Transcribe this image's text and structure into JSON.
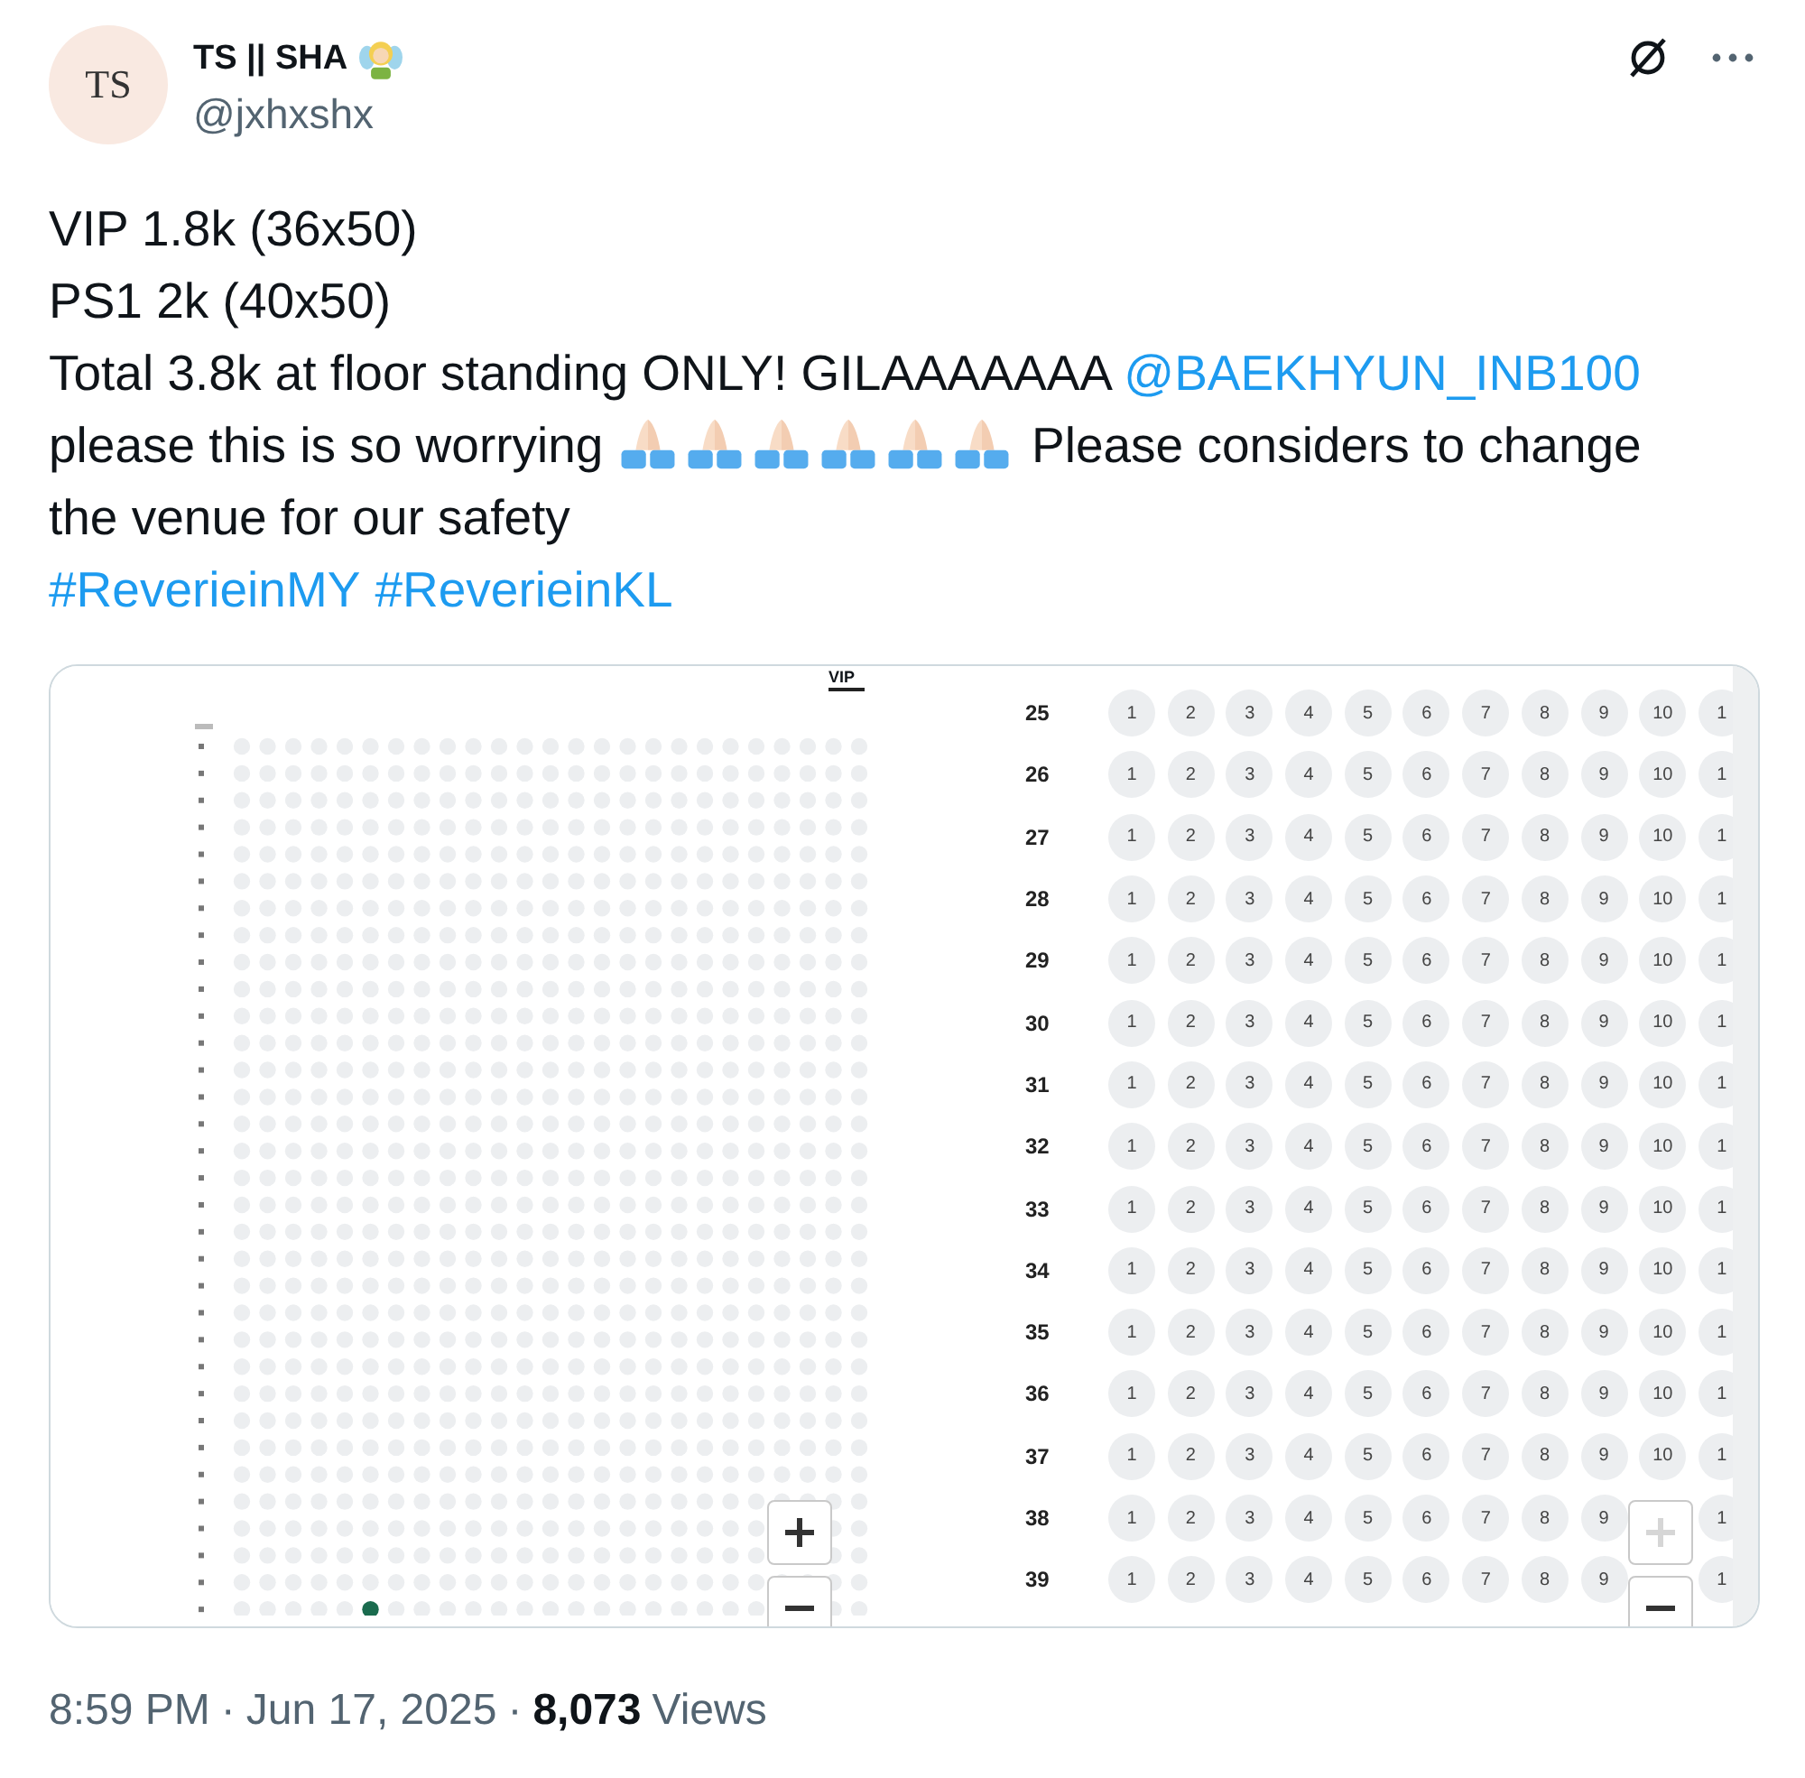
{
  "author": {
    "avatar_text": "TS",
    "name": "TS || SHA",
    "handle": "@jxhxshx"
  },
  "body": {
    "lines": [
      {
        "parts": [
          {
            "kind": "text",
            "text": "VIP 1.8k (36x50)"
          }
        ]
      },
      {
        "parts": [
          {
            "kind": "text",
            "text": "PS1 2k (40x50)"
          }
        ]
      },
      {
        "parts": [
          {
            "kind": "text",
            "text": "Total 3.8k at floor standing ONLY! GILAAAAAAA "
          },
          {
            "kind": "mention",
            "text": "@BAEKHYUN_INB100"
          }
        ]
      },
      {
        "parts": [
          {
            "kind": "text",
            "text": "please this is so worrying "
          },
          {
            "kind": "pray"
          },
          {
            "kind": "pray"
          },
          {
            "kind": "pray"
          },
          {
            "kind": "pray"
          },
          {
            "kind": "pray"
          },
          {
            "kind": "pray"
          },
          {
            "kind": "text",
            "text": " Please considers to change"
          }
        ]
      },
      {
        "parts": [
          {
            "kind": "text",
            "text": "the venue for our safety"
          }
        ]
      },
      {
        "parts": [
          {
            "kind": "hashtag",
            "text": "#ReverieinMY"
          },
          {
            "kind": "hashtag",
            "text": "#ReverieinKL"
          }
        ]
      }
    ]
  },
  "media": {
    "left_map": {
      "title": "VIP",
      "zoom": [
        {
          "kind": "zoom-in",
          "disabled": false
        },
        {
          "kind": "zoom-out",
          "disabled": false
        }
      ]
    },
    "right_map": {
      "rows": [
        {
          "label": "25",
          "seats": [
            "1",
            "2",
            "3",
            "4",
            "5",
            "6",
            "7",
            "8",
            "9",
            "10",
            "1"
          ]
        },
        {
          "label": "26",
          "seats": [
            "1",
            "2",
            "3",
            "4",
            "5",
            "6",
            "7",
            "8",
            "9",
            "10",
            "1"
          ]
        },
        {
          "label": "27",
          "seats": [
            "1",
            "2",
            "3",
            "4",
            "5",
            "6",
            "7",
            "8",
            "9",
            "10",
            "1"
          ]
        },
        {
          "label": "28",
          "seats": [
            "1",
            "2",
            "3",
            "4",
            "5",
            "6",
            "7",
            "8",
            "9",
            "10",
            "1"
          ]
        },
        {
          "label": "29",
          "seats": [
            "1",
            "2",
            "3",
            "4",
            "5",
            "6",
            "7",
            "8",
            "9",
            "10",
            "1"
          ]
        },
        {
          "label": "30",
          "seats": [
            "1",
            "2",
            "3",
            "4",
            "5",
            "6",
            "7",
            "8",
            "9",
            "10",
            "1"
          ]
        },
        {
          "label": "31",
          "seats": [
            "1",
            "2",
            "3",
            "4",
            "5",
            "6",
            "7",
            "8",
            "9",
            "10",
            "1"
          ]
        },
        {
          "label": "32",
          "seats": [
            "1",
            "2",
            "3",
            "4",
            "5",
            "6",
            "7",
            "8",
            "9",
            "10",
            "1"
          ]
        },
        {
          "label": "33",
          "seats": [
            "1",
            "2",
            "3",
            "4",
            "5",
            "6",
            "7",
            "8",
            "9",
            "10",
            "1"
          ]
        },
        {
          "label": "34",
          "seats": [
            "1",
            "2",
            "3",
            "4",
            "5",
            "6",
            "7",
            "8",
            "9",
            "10",
            "1"
          ]
        },
        {
          "label": "35",
          "seats": [
            "1",
            "2",
            "3",
            "4",
            "5",
            "6",
            "7",
            "8",
            "9",
            "10",
            "1"
          ]
        },
        {
          "label": "36",
          "seats": [
            "1",
            "2",
            "3",
            "4",
            "5",
            "6",
            "7",
            "8",
            "9",
            "10",
            "1"
          ]
        },
        {
          "label": "37",
          "seats": [
            "1",
            "2",
            "3",
            "4",
            "5",
            "6",
            "7",
            "8",
            "9",
            "10",
            "1"
          ]
        },
        {
          "label": "38",
          "seats": [
            "1",
            "2",
            "3",
            "4",
            "5",
            "6",
            "7",
            "8",
            "9"
          ],
          "seats_past_button": [
            "1"
          ]
        },
        {
          "label": "39",
          "seats": [
            "1",
            "2",
            "3",
            "4",
            "5",
            "6",
            "7",
            "8",
            "9"
          ],
          "seats_past_button": [
            "1"
          ]
        }
      ],
      "zoom": [
        {
          "kind": "zoom-in",
          "disabled": true
        },
        {
          "kind": "zoom-out",
          "disabled": false
        }
      ]
    }
  },
  "footer": {
    "parts": [
      {
        "kind": "meta",
        "text": "8:59 PM"
      },
      {
        "kind": "separator",
        "text": "·"
      },
      {
        "kind": "meta",
        "text": "Jun 17, 2025"
      },
      {
        "kind": "separator",
        "text": "·"
      },
      {
        "kind": "count",
        "text": "8,073"
      },
      {
        "kind": "meta",
        "text": "Views"
      }
    ]
  }
}
